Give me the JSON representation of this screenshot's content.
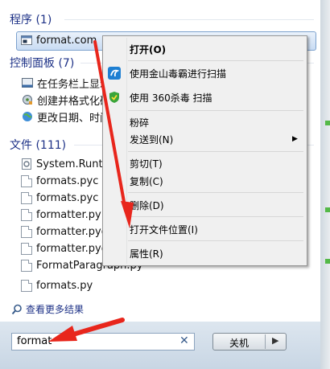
{
  "sections": {
    "programs": {
      "title": "程序 (1)",
      "items": [
        {
          "label": "format.com",
          "icon": "console-app-icon"
        }
      ]
    },
    "control_panel": {
      "title": "控制面板 (7)",
      "items": [
        {
          "label": "在任务栏上显示",
          "icon": "taskbar-icon"
        },
        {
          "label": "创建并格式化硬",
          "icon": "disk-management-icon"
        },
        {
          "label": "更改日期、时间",
          "icon": "globe-clock-icon"
        }
      ]
    },
    "files": {
      "title": "文件 (111)",
      "items": [
        {
          "label": "System.Runtim",
          "icon": "dll-file-icon"
        },
        {
          "label": "formats.pyc",
          "icon": "file-icon"
        },
        {
          "label": "formats.pyc",
          "icon": "file-icon"
        },
        {
          "label": "formatter.py",
          "icon": "file-icon"
        },
        {
          "label": "formatter.pyc",
          "icon": "file-icon"
        },
        {
          "label": "formatter.pyo",
          "icon": "file-icon"
        },
        {
          "label": "FormatParagraph.py",
          "icon": "file-icon"
        },
        {
          "label": "formats.py",
          "icon": "file-icon"
        }
      ]
    }
  },
  "see_more": "查看更多结果",
  "search": {
    "value": "format"
  },
  "shutdown_label": "关机",
  "context_menu": {
    "items": [
      {
        "label": "打开(O)",
        "bold": true
      },
      {
        "label": "使用金山毒霸进行扫描",
        "icon": "kingsoft-antivirus-icon"
      },
      {
        "label": "使用 360杀毒 扫描",
        "icon": "360-shield-icon"
      },
      {
        "label": "粉碎"
      },
      {
        "label": "发送到(N)",
        "submenu": true
      },
      {
        "label": "剪切(T)"
      },
      {
        "label": "复制(C)"
      },
      {
        "label": "删除(D)"
      },
      {
        "label": "打开文件位置(I)"
      },
      {
        "label": "属性(R)"
      }
    ]
  },
  "colors": {
    "annotation_arrow": "#e8261c",
    "section_title": "#1e3287"
  }
}
